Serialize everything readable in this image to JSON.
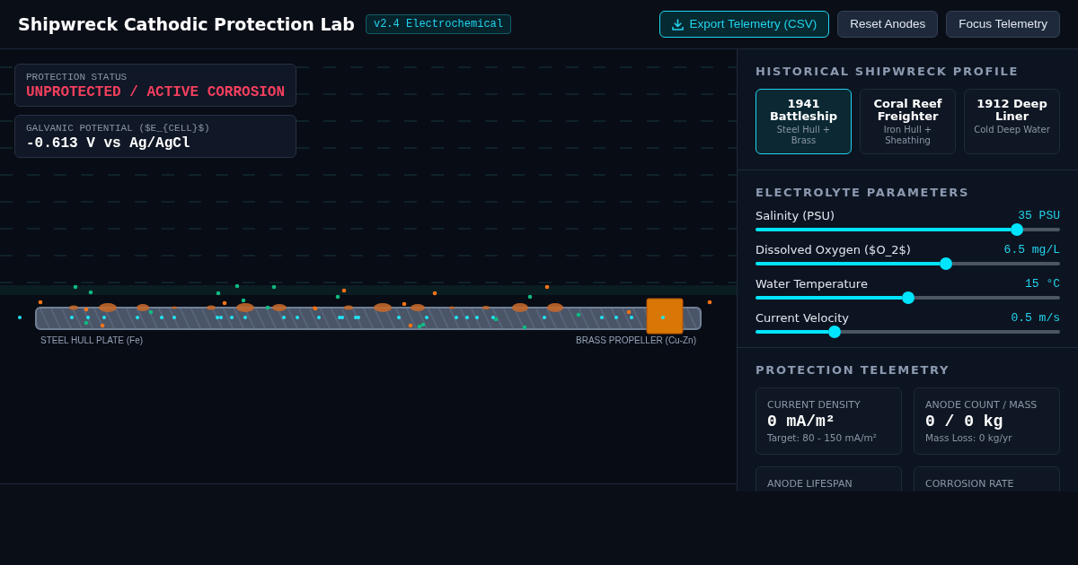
{
  "header": {
    "title": "Shipwreck Cathodic Protection Lab",
    "badge": "v2.4 Electrochemical",
    "buttons": [
      {
        "label": "Export Telemetry (CSV)",
        "kind": "primary"
      },
      {
        "label": "Reset Anodes",
        "kind": "secondary"
      },
      {
        "label": "Focus Telemetry",
        "kind": "secondary"
      }
    ]
  },
  "simulation": {
    "status": {
      "label": "PROTECTION STATUS",
      "value": "UNPROTECTED / ACTIVE CORROSION",
      "protected": false
    },
    "potential": {
      "label": "GALVANIC POTENTIAL ($E_{CELL}$)",
      "value": "-0.613 V vs Ag/AgCl"
    },
    "hull_label": "STEEL HULL PLATE (Fe)",
    "propeller_label": "BRASS PROPELLER (Cu-Zn)"
  },
  "profile": {
    "title": "HISTORICAL SHIPWRECK PROFILE",
    "items": [
      {
        "name": "1941 Battleship",
        "description": "Steel Hull + Brass",
        "selected": true
      },
      {
        "name": "Coral Reef Freighter",
        "description": "Iron Hull + Sheathing",
        "selected": false
      },
      {
        "name": "1912 Deep Liner",
        "description": "Cold Deep Water",
        "selected": false
      }
    ]
  },
  "electrolyte": {
    "title": "ELECTROLYTE PARAMETERS",
    "sliders": [
      {
        "label": "Salinity (PSU)",
        "reading": "35 PSU",
        "level": 0.875
      },
      {
        "label": "Dissolved Oxygen ($O_2$)",
        "reading": "6.5 mg/L",
        "level": 0.63
      },
      {
        "label": "Water Temperature",
        "reading": "15 °C",
        "level": 0.5
      },
      {
        "label": "Current Velocity",
        "reading": "0.5 m/s",
        "level": 0.25
      }
    ]
  },
  "telemetry": {
    "title": "PROTECTION TELEMETRY",
    "cards": [
      {
        "label": "CURRENT DENSITY",
        "value": "0 mA/m²",
        "note": "Target: 80 - 150 mA/m²"
      },
      {
        "label": "ANODE COUNT / MASS",
        "value": "0 / 0 kg",
        "note": "Mass Loss: 0 kg/yr"
      },
      {
        "label": "ANODE LIFESPAN"
      },
      {
        "label": "CORROSION RATE"
      }
    ]
  }
}
